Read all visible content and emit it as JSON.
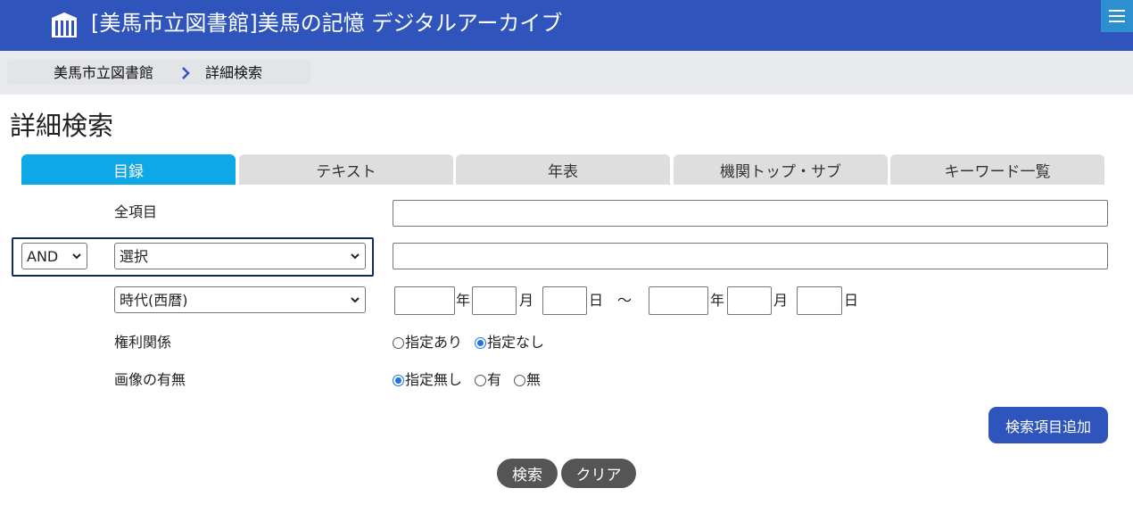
{
  "header": {
    "site_title": "[美馬市立図書館]美馬の記憶 デジタルアーカイブ",
    "logo_icon": "library-building-icon",
    "menu_icon": "hamburger-menu-icon",
    "brand_color": "#2f55bd"
  },
  "breadcrumb": {
    "home": "美馬市立図書館",
    "separator_icon": "chevron-right-icon",
    "current": "詳細検索"
  },
  "page": {
    "title": "詳細検索"
  },
  "tabs": [
    {
      "label": "目録",
      "active": true
    },
    {
      "label": "テキスト",
      "active": false
    },
    {
      "label": "年表",
      "active": false
    },
    {
      "label": "機関トップ・サブ",
      "active": false
    },
    {
      "label": "キーワード一覧",
      "active": false
    }
  ],
  "form": {
    "all_fields_label": "全項目",
    "all_fields_value": "",
    "operator_select": "AND",
    "field_select": "選択",
    "field_value": "",
    "era_select": "時代(西暦)",
    "date_units": {
      "year": "年",
      "month": "月",
      "day": "日",
      "tilde": "～"
    },
    "rights_label": "権利関係",
    "rights_options": [
      {
        "label": "指定あり",
        "checked": false
      },
      {
        "label": "指定なし",
        "checked": true
      }
    ],
    "image_label": "画像の有無",
    "image_options": [
      {
        "label": "指定無し",
        "checked": true
      },
      {
        "label": "有",
        "checked": false
      },
      {
        "label": "無",
        "checked": false
      }
    ]
  },
  "buttons": {
    "add_field": "検索項目追加",
    "search": "検索",
    "clear": "クリア"
  }
}
